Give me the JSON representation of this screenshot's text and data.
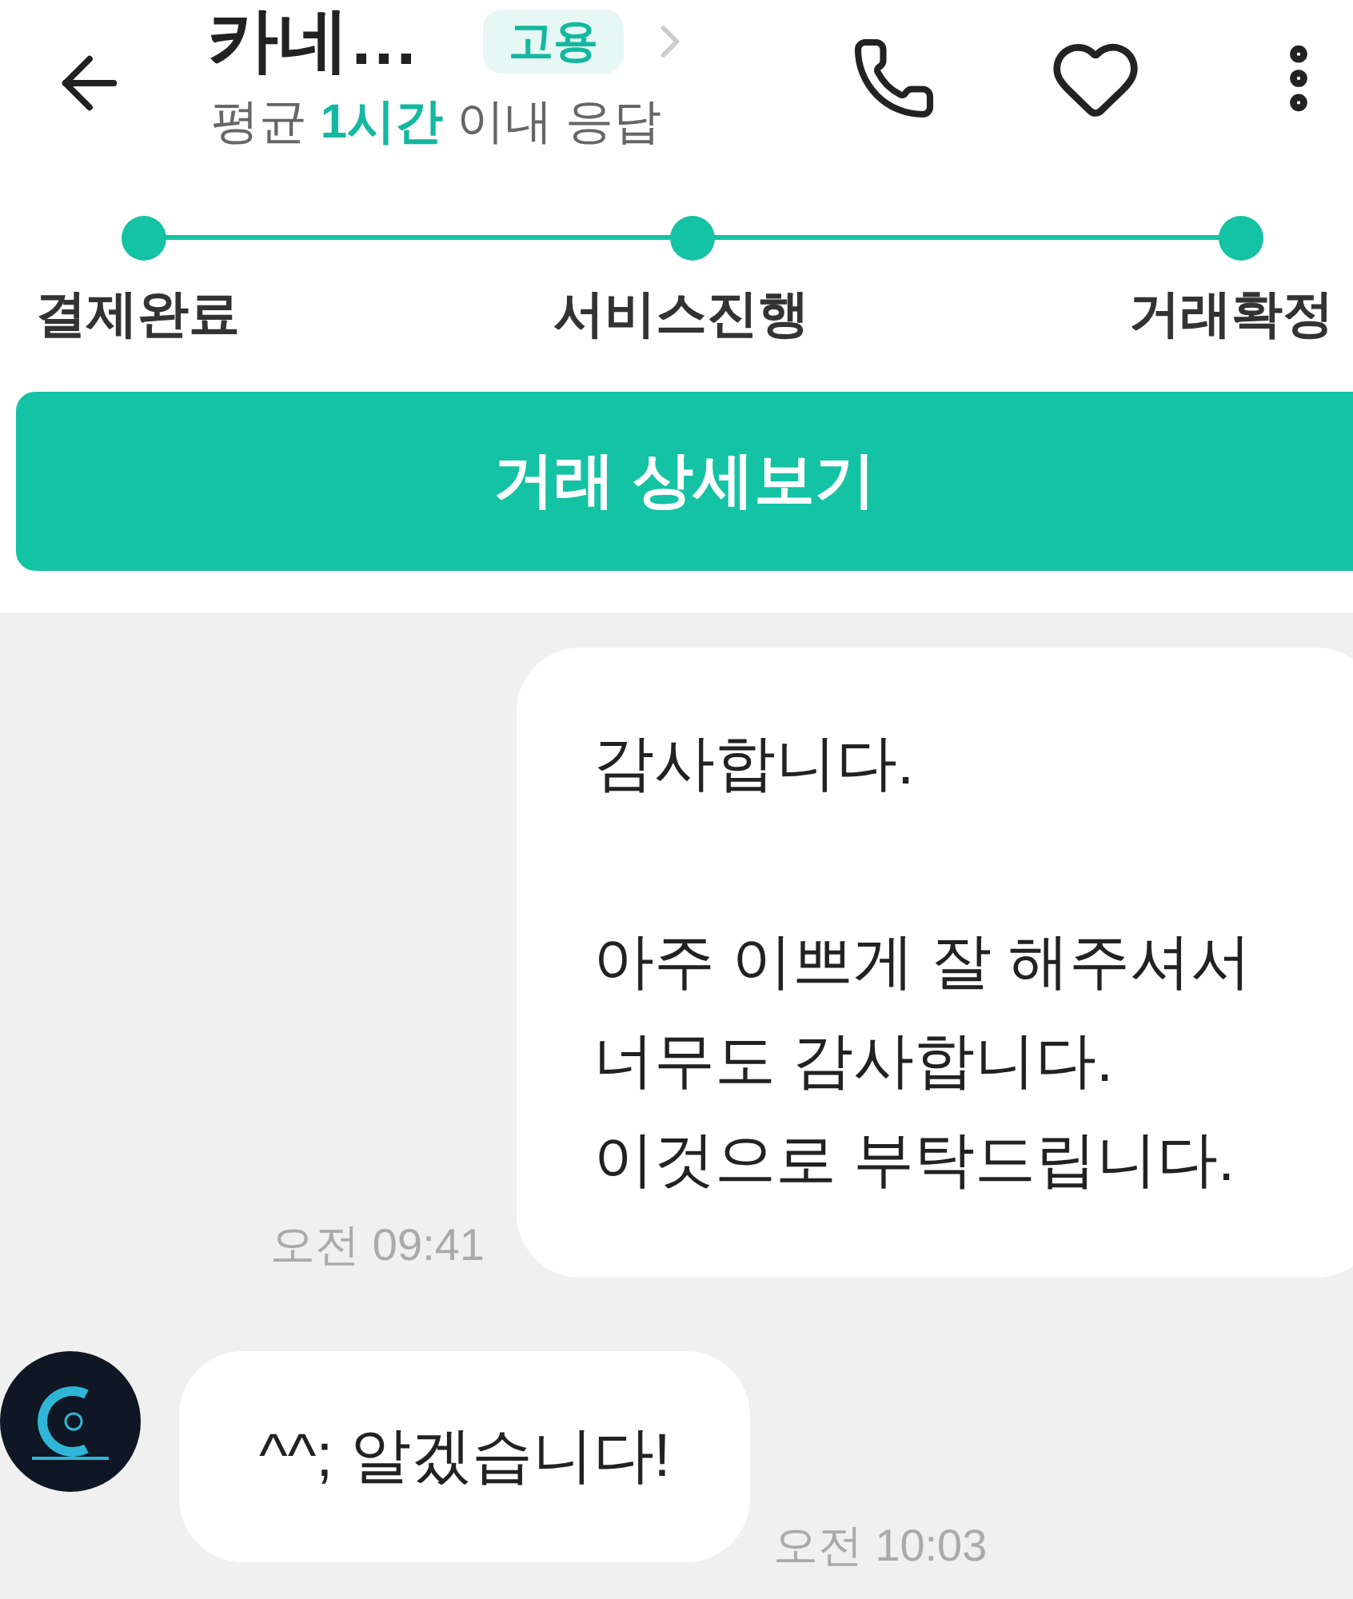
{
  "header": {
    "title": "카네…",
    "badge": "고용",
    "response": {
      "prefix": "평균 ",
      "highlight": "1시간",
      "suffix": " 이내 응답"
    }
  },
  "progress": {
    "steps": [
      {
        "label": "결제완료",
        "done": true
      },
      {
        "label": "서비스진행",
        "done": true
      },
      {
        "label": "거래확정",
        "done": true
      }
    ]
  },
  "detail_button": "거래 상세보기",
  "messages": [
    {
      "kind": "sent",
      "text": "감사합니다.\n\n아주 이쁘게 잘 해주셔서\n너무도 감사합니다.\n이것으로 부탁드립니다.",
      "time": "오전 09:41"
    },
    {
      "kind": "received",
      "text": "^^; 알겠습니다!",
      "time": "오전 10:03"
    }
  ]
}
